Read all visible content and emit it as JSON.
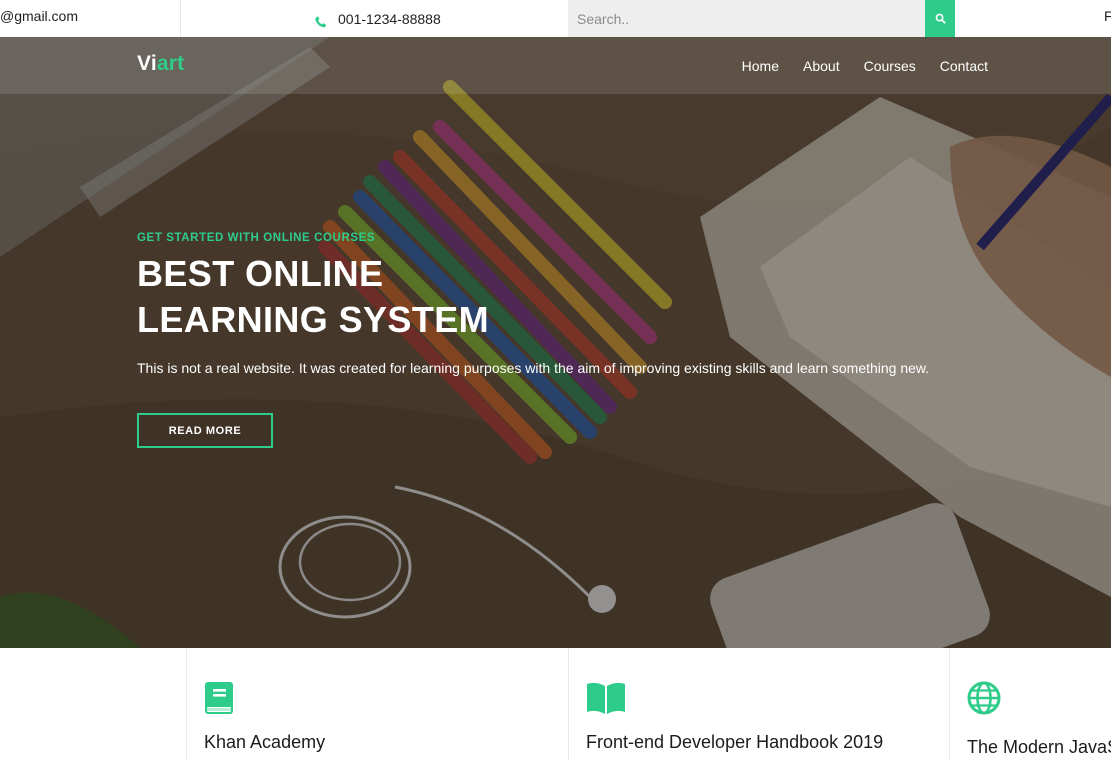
{
  "topbar": {
    "email": "@gmail.com",
    "phone": "001-1234-88888",
    "search_placeholder": "Search..",
    "extra": "F"
  },
  "nav": {
    "logo_main": "Vi",
    "logo_accent": "art",
    "items": [
      {
        "label": "Home"
      },
      {
        "label": "About"
      },
      {
        "label": "Courses"
      },
      {
        "label": "Contact"
      }
    ]
  },
  "hero": {
    "kicker": "GET STARTED WITH ONLINE COURSES",
    "headline_line1": "BEST ONLINE",
    "headline_line2": "LEARNING SYSTEM",
    "lead": "This is not a real website. It was created for learning purposes with the aim of improving existing skills and learn something new.",
    "cta": "READ MORE"
  },
  "cards": [
    {
      "title": "Khan Academy",
      "icon": "book-icon"
    },
    {
      "title": "Front-end Developer Handbook 2019",
      "icon": "open-book-icon"
    },
    {
      "title": "The Modern JavaS",
      "icon": "globe-icon"
    }
  ],
  "colors": {
    "accent": "#2ecc8a",
    "text": "#222222",
    "white": "#ffffff"
  }
}
